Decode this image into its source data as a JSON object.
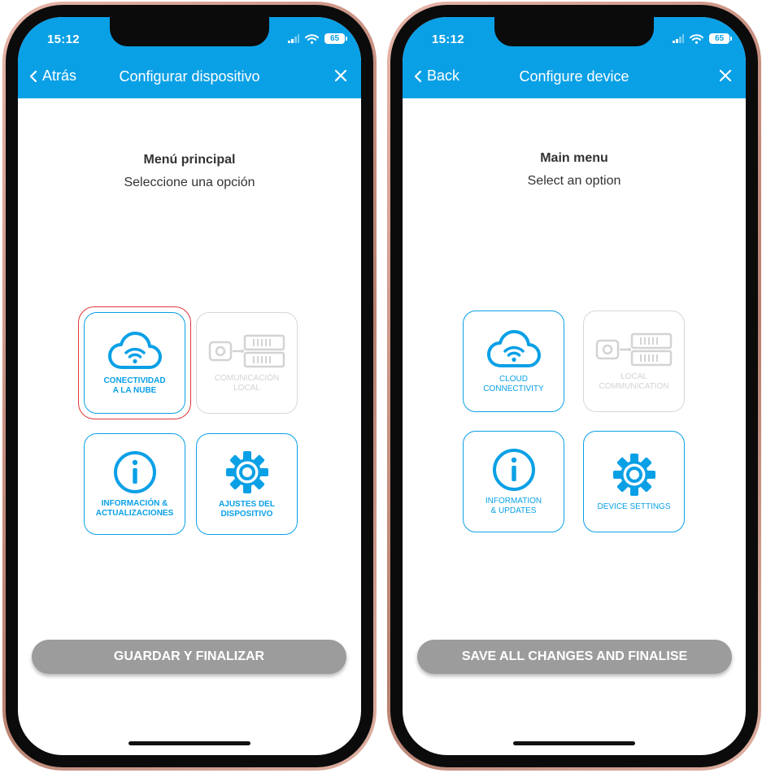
{
  "colors": {
    "accent": "#0aa0e6",
    "disabled": "#d3d3d3",
    "selection": "#e0353b",
    "button": "#9c9c9c"
  },
  "phones": [
    {
      "status": {
        "time": "15:12",
        "battery": "65"
      },
      "header": {
        "back_label": "Atrás",
        "title": "Configurar dispositivo"
      },
      "content": {
        "title": "Menú principal",
        "subtitle": "Seleccione una opción"
      },
      "tiles": [
        {
          "icon": "cloud-wifi-icon",
          "label": "CONECTIVIDAD\nA LA NUBE",
          "enabled": true,
          "selected": true
        },
        {
          "icon": "local-network-icon",
          "label": "COMUNICACIÓN\nLOCAL",
          "enabled": false,
          "selected": false
        },
        {
          "icon": "info-icon",
          "label": "INFORMACIÓN &\nACTUALIZACIONES",
          "enabled": true,
          "selected": false
        },
        {
          "icon": "gear-icon",
          "label": "AJUSTES DEL\nDISPOSITIVO",
          "enabled": true,
          "selected": false
        }
      ],
      "save_label": "GUARDAR Y FINALIZAR"
    },
    {
      "status": {
        "time": "15:12",
        "battery": "65"
      },
      "header": {
        "back_label": "Back",
        "title": "Configure device"
      },
      "content": {
        "title": "Main menu",
        "subtitle": "Select an option"
      },
      "tiles": [
        {
          "icon": "cloud-wifi-icon",
          "label": "CLOUD\nCONNECTIVITY",
          "enabled": true,
          "selected": false
        },
        {
          "icon": "local-network-icon",
          "label": "LOCAL\nCOMMUNICATION",
          "enabled": false,
          "selected": false
        },
        {
          "icon": "info-icon",
          "label": "INFORMATION\n& UPDATES",
          "enabled": true,
          "selected": false
        },
        {
          "icon": "gear-icon",
          "label": "DEVICE SETTINGS",
          "enabled": true,
          "selected": false
        }
      ],
      "save_label": "SAVE ALL CHANGES AND FINALISE"
    }
  ]
}
